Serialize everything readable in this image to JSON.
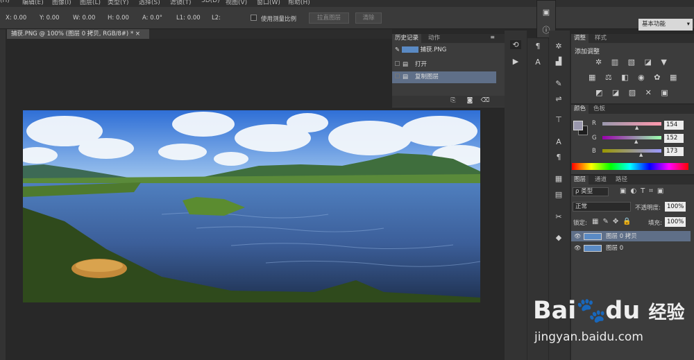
{
  "menubar": [
    "(H)",
    "编辑(E)",
    "图像(I)",
    "图层(L)",
    "类型(Y)",
    "选择(S)",
    "滤镜(T)",
    "3D(D)",
    "视图(V)",
    "窗口(W)",
    "帮助(H)"
  ],
  "options": {
    "x": "X: 0.00",
    "y": "Y: 0.00",
    "w": "W: 0.00",
    "h": "H: 0.00",
    "a": "A: 0.0°",
    "l1": "L1: 0.00",
    "l2": "L2:",
    "use_scale": "使用测量比例",
    "straighten": "拉直图层",
    "clear": "清除",
    "workspace": "基本功能"
  },
  "doc_tab": {
    "title": "捕获.PNG @ 100% (图层 0 拷贝, RGB/8#) *",
    "close": "×"
  },
  "history": {
    "tab_history": "历史记录",
    "tab_actions": "动作",
    "snapshot": "捕获.PNG",
    "items": [
      "打开",
      "复制图层"
    ]
  },
  "adjust": {
    "tab_adjust": "调整",
    "tab_styles": "样式",
    "add_label": "添加调整"
  },
  "color": {
    "tab_color": "颜色",
    "tab_swatches": "色板",
    "r_label": "R",
    "g_label": "G",
    "b_label": "B",
    "r": "154",
    "g": "152",
    "b": "173",
    "fg": "#9a98ad",
    "bg": "#1e1e1e"
  },
  "layers": {
    "tab_layers": "图层",
    "tab_channels": "通道",
    "tab_paths": "路径",
    "kind": "ρ 类型",
    "blend": "正常",
    "opacity_label": "不透明度:",
    "opacity": "100%",
    "lock_label": "锁定:",
    "fill_label": "填充:",
    "fill": "100%",
    "items": [
      {
        "name": "图层 0 拷贝",
        "selected": true
      },
      {
        "name": "图层 0",
        "selected": false
      }
    ]
  },
  "watermark": {
    "brand_a": "Bai",
    "brand_b": "du",
    "brand_c": "经验",
    "url": "jingyan.baidu.com"
  }
}
